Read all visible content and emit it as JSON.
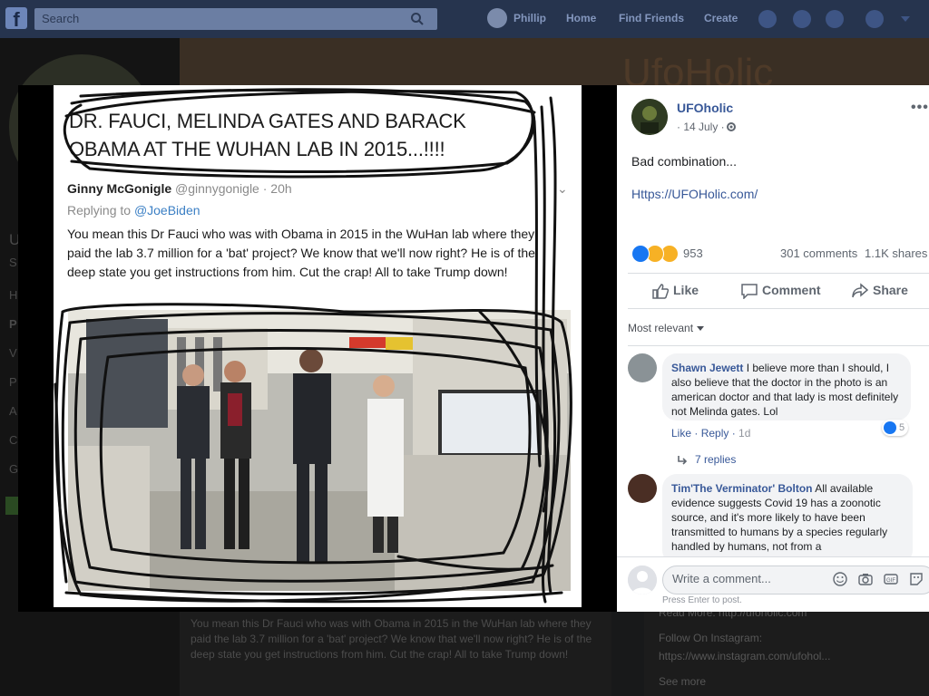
{
  "nav": {
    "search_placeholder": "Search",
    "user_name": "Phillip",
    "home": "Home",
    "find_friends": "Find Friends",
    "create": "Create"
  },
  "background": {
    "cover_title": "UfoHolic",
    "left_letters": [
      "U",
      "S",
      "H",
      "P",
      "V",
      "P",
      "A",
      "C",
      "G"
    ],
    "post_text": "You mean this Dr Fauci who was with Obama in 2015 in the WuHan lab where they paid the lab 3.7 million for a 'bat' project? We know that we'll now right? He is of the deep state you get instructions from him. Cut the crap! All to take Trump down!",
    "side_lines": [
      "Read More: http://ufoholic.com",
      "Follow On Instagram:",
      "https://www.instagram.com/ufohol...",
      "See more"
    ]
  },
  "photo": {
    "caption": "DR. FAUCI, MELINDA GATES AND BARACK OBAMA AT THE WUHAN LAB IN 2015...!!!!",
    "tweet_author": "Ginny McGonigle",
    "tweet_handle": "@ginnygonigle · 20h",
    "tweet_replying_prefix": "Replying to ",
    "tweet_replying_to": "@JoeBiden",
    "tweet_body": "You mean this Dr Fauci who was with Obama in 2015 in the WuHan lab where they paid the lab 3.7 million for a 'bat' project? We know that we'll now right? He is of the deep state you get instructions from him. Cut the crap! All to take Trump down!"
  },
  "post": {
    "page_name": "UFOholic",
    "date": "· 14 July ·",
    "text": "Bad combination...",
    "link": "Https://UFOHolic.com/",
    "reaction_count": "953",
    "comments_count": "301 comments",
    "shares_count": "1.1K shares",
    "more_label": "•••",
    "reactions": [
      "like-icon",
      "wow-icon",
      "haha-icon"
    ]
  },
  "actions": {
    "like": "Like",
    "comment": "Comment",
    "share": "Share"
  },
  "comments": {
    "sort_label": "Most relevant",
    "items": [
      {
        "author": "Shawn Jewett",
        "text": " I believe more than I should, I also believe that the doctor in the photo is an american doctor and that lady is most definitely not Melinda gates. Lol",
        "like": "Like",
        "reply": "Reply",
        "time": "1d",
        "likes": "5",
        "replies": "7 replies"
      },
      {
        "author": "Tim'The Verminator' Bolton",
        "text": " All available evidence suggests Covid 19 has a zoonotic source, and it's more likely to have been transmitted to humans by a species regularly handled by humans, not from a"
      }
    ],
    "composer_placeholder": "Write a comment...",
    "press_enter": "Press Enter to post."
  },
  "colors": {
    "facebook_blue": "#385898",
    "nav_blue": "#4267b2",
    "like_blue": "#1877f2"
  }
}
